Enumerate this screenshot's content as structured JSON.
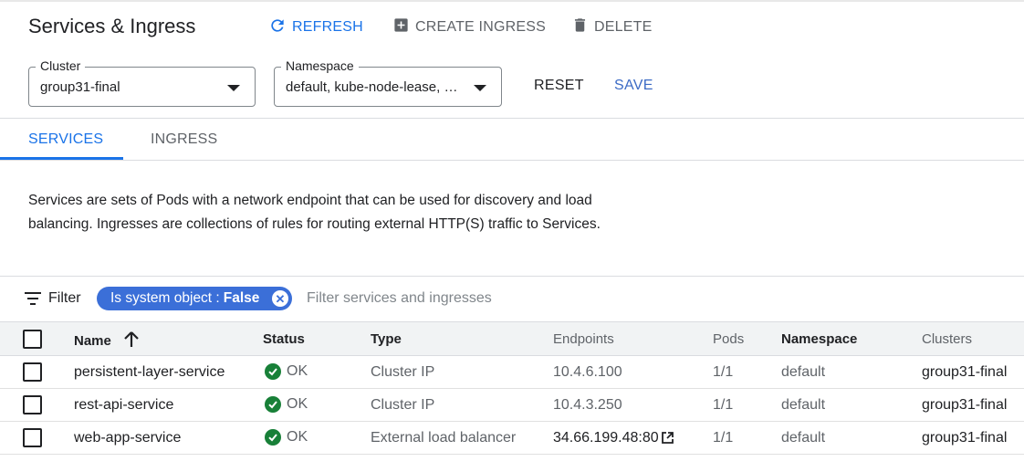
{
  "header": {
    "title": "Services & Ingress",
    "refresh_label": "REFRESH",
    "create_ingress_label": "CREATE INGRESS",
    "delete_label": "DELETE"
  },
  "selectors": {
    "cluster": {
      "label": "Cluster",
      "value": "group31-final"
    },
    "namespace": {
      "label": "Namespace",
      "value": "default, kube-node-lease, …"
    },
    "reset_label": "RESET",
    "save_label": "SAVE"
  },
  "tabs": [
    {
      "label": "SERVICES",
      "active": true
    },
    {
      "label": "INGRESS",
      "active": false
    }
  ],
  "description": "Services are sets of Pods with a network endpoint that can be used for discovery and load balancing. Ingresses are collections of rules for routing external HTTP(S) traffic to Services.",
  "filter": {
    "label": "Filter",
    "chip_key": "Is system object :",
    "chip_value": "False",
    "placeholder": "Filter services and ingresses"
  },
  "table": {
    "columns": [
      "Name",
      "Status",
      "Type",
      "Endpoints",
      "Pods",
      "Namespace",
      "Clusters"
    ],
    "rows": [
      {
        "name": "persistent-layer-service",
        "status": "OK",
        "type": "Cluster IP",
        "endpoints": "10.4.6.100",
        "pods": "1/1",
        "namespace": "default",
        "cluster": "group31-final"
      },
      {
        "name": "rest-api-service",
        "status": "OK",
        "type": "Cluster IP",
        "endpoints": "10.4.3.250",
        "pods": "1/1",
        "namespace": "default",
        "cluster": "group31-final"
      },
      {
        "name": "web-app-service",
        "status": "OK",
        "type": "External load balancer",
        "endpoints": "34.66.199.48:80",
        "pods": "1/1",
        "namespace": "default",
        "cluster": "group31-final"
      }
    ]
  },
  "colors": {
    "accent": "#1a73e8",
    "chip": "#3b6fd8",
    "ok": "#188038"
  }
}
